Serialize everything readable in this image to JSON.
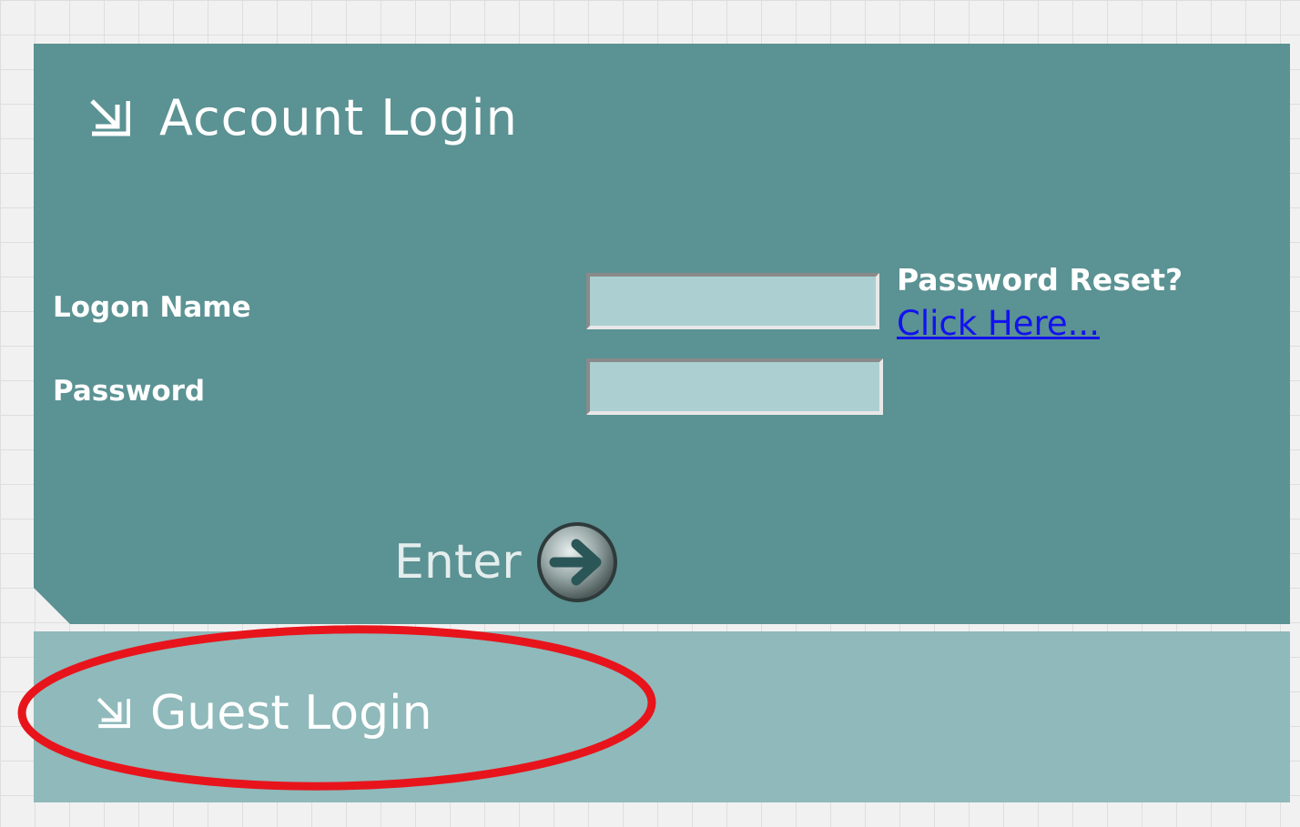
{
  "account_login": {
    "title": "Account Login",
    "title_icon": "arrow-down-right-icon",
    "logon_name_label": "Logon Name",
    "logon_name_value": "",
    "password_label": "Password",
    "password_value": "",
    "password_reset_label": "Password Reset?",
    "password_reset_link": "Click Here...",
    "enter_label": "Enter",
    "enter_icon": "arrow-right-circle-icon"
  },
  "guest_login": {
    "title": "Guest Login",
    "title_icon": "arrow-down-right-icon"
  },
  "colors": {
    "account_panel": "#5b9293",
    "guest_panel": "#8fb9ba",
    "input_fill": "#acd0d1",
    "link": "#1212ee",
    "annotation": "#e8141c"
  }
}
